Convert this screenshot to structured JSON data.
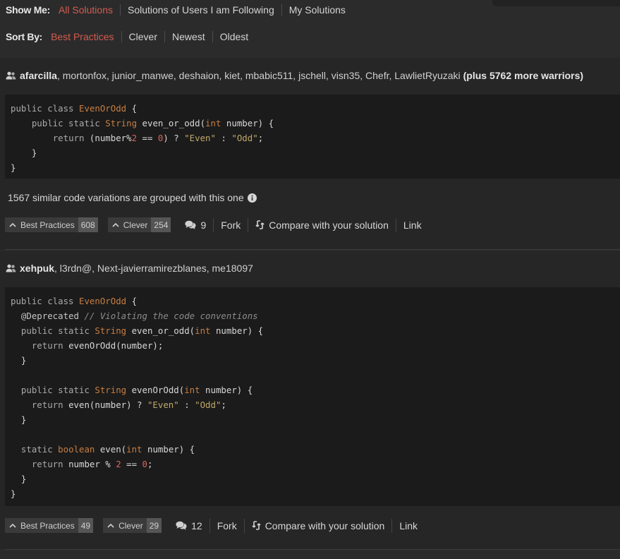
{
  "filters": {
    "show_label": "Show Me:",
    "show_options": [
      "All Solutions",
      "Solutions of Users I am Following",
      "My Solutions"
    ],
    "show_active": "All Solutions",
    "sort_label": "Sort By:",
    "sort_options": [
      "Best Practices",
      "Clever",
      "Newest",
      "Oldest"
    ],
    "sort_active": "Best Practices"
  },
  "solutions": [
    {
      "lead_author": "afarcilla",
      "other_authors": ", mortonfox, junior_manwe, deshaion, kiet, mbabic511, jschell, visn35, Chefr, LawlietRyuzaki",
      "more_warriors": "(plus 5762 more warriors)",
      "variations_text": "1567 similar code variations are grouped with this one",
      "best_practices_label": "Best Practices",
      "best_practices_count": "608",
      "clever_label": "Clever",
      "clever_count": "254",
      "comments_count": "9",
      "fork_label": "Fork",
      "compare_label": "Compare with your solution",
      "link_label": "Link"
    },
    {
      "lead_author": "xehpuk",
      "other_authors": ", l3rdn@, Next-javierramirezblanes, me18097",
      "best_practices_label": "Best Practices",
      "best_practices_count": "49",
      "clever_label": "Clever",
      "clever_count": "29",
      "comments_count": "12",
      "fork_label": "Fork",
      "compare_label": "Compare with your solution",
      "link_label": "Link"
    }
  ],
  "colors": {
    "accent": "#d25c4d",
    "background": "#2b2b2c",
    "code_bg": "#1b1b1b"
  },
  "icons": [
    "users-icon",
    "info-icon",
    "caret-up-icon",
    "comments-icon",
    "compare-icon"
  ]
}
